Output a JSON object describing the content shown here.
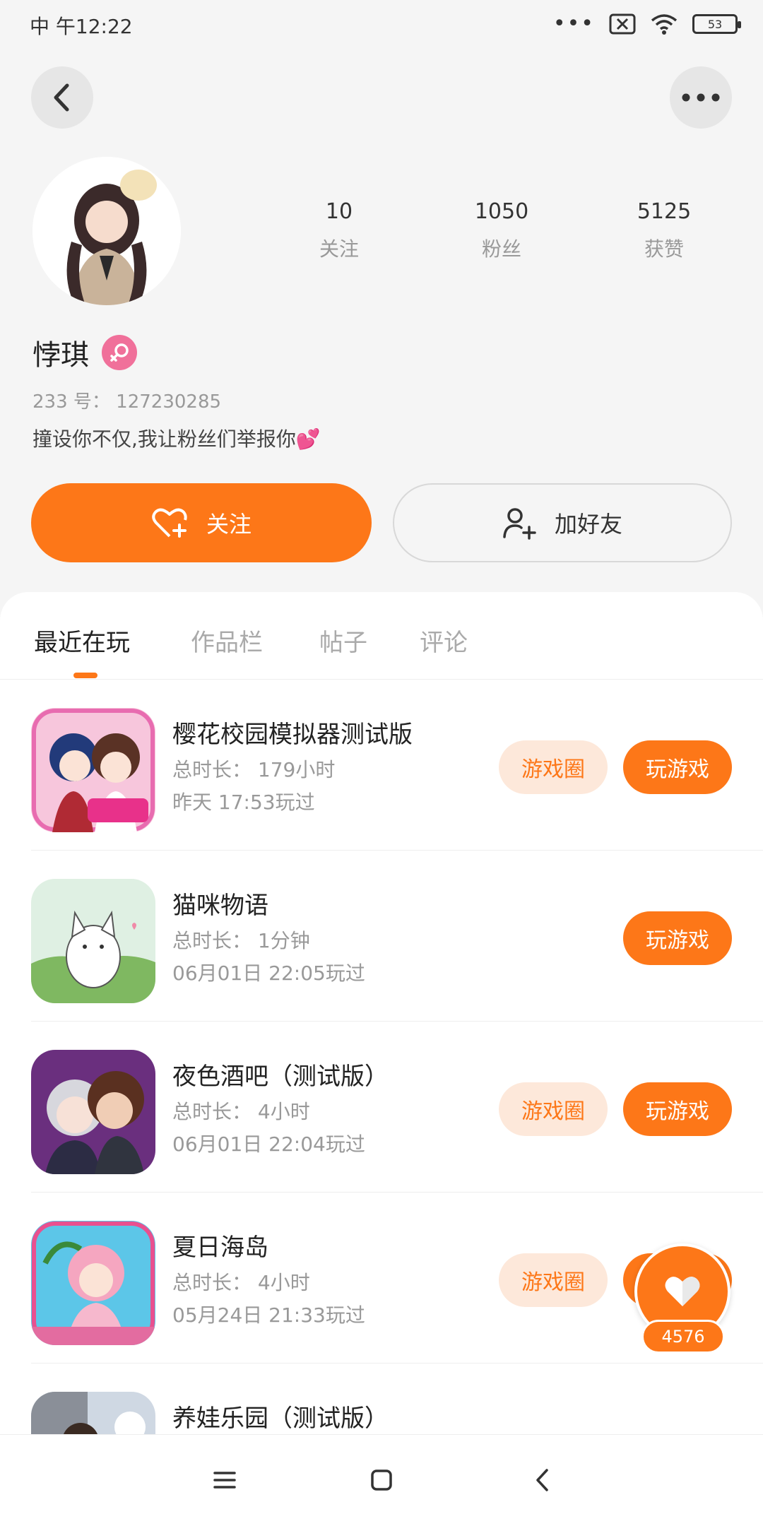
{
  "status_bar": {
    "time": "中 午12:22",
    "battery": "53"
  },
  "profile": {
    "name": "悖琪",
    "uid_label": "233 号：",
    "uid_value": "127230285",
    "bio": "撞设你不仅,我让粉丝们举报你💕",
    "stats": [
      {
        "value": "10",
        "label": "关注"
      },
      {
        "value": "1050",
        "label": "粉丝"
      },
      {
        "value": "5125",
        "label": "获赞"
      }
    ],
    "follow_label": "关注",
    "add_friend_label": "加好友"
  },
  "tabs": [
    "最近在玩",
    "作品栏",
    "帖子",
    "评论"
  ],
  "games": [
    {
      "title": "樱花校园模拟器测试版",
      "duration": "总时长：  179小时",
      "last_played": "昨天   17:53玩过",
      "circle_label": "游戏圈",
      "play_label": "玩游戏",
      "has_circle": true
    },
    {
      "title": "猫咪物语",
      "duration": "总时长：  1分钟",
      "last_played": "06月01日   22:05玩过",
      "circle_label": "",
      "play_label": "玩游戏",
      "has_circle": false
    },
    {
      "title": "夜色酒吧（测试版）",
      "duration": "总时长：  4小时",
      "last_played": "06月01日   22:04玩过",
      "circle_label": "游戏圈",
      "play_label": "玩游戏",
      "has_circle": true
    },
    {
      "title": "夏日海岛",
      "duration": "总时长：  4小时",
      "last_played": "05月24日   21:33玩过",
      "circle_label": "游戏圈",
      "play_label": "玩游戏",
      "has_circle": true
    },
    {
      "title": "养娃乐园（测试版）",
      "duration": "",
      "last_played": "",
      "circle_label": "",
      "play_label": "",
      "has_circle": false
    }
  ],
  "floating_like": {
    "count": "4576"
  },
  "icons": [
    "back-icon",
    "more-icon",
    "heart-plus-icon",
    "add-user-icon",
    "female-icon",
    "heart-icon",
    "menu-icon",
    "home-icon",
    "nav-back-icon"
  ],
  "colors": {
    "accent": "#fd7718",
    "accent_light": "#fde8da",
    "female": "#f0709a"
  }
}
